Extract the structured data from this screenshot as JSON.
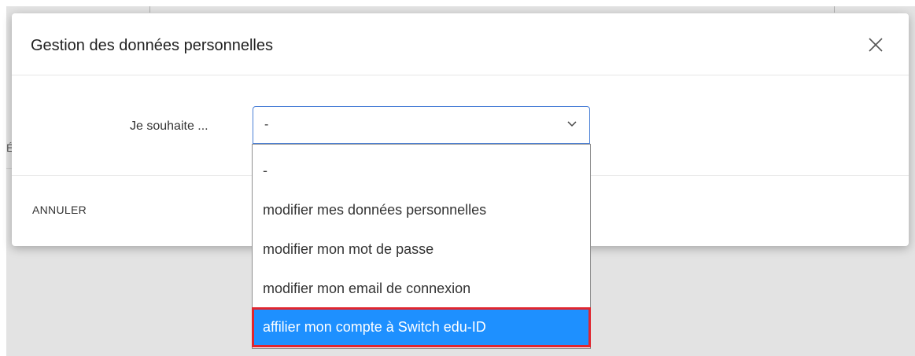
{
  "dialog": {
    "title": "Gestion des données personnelles",
    "close_icon": "close-icon",
    "cancel_label": "ANNULER"
  },
  "form": {
    "label": "Je souhaite ...",
    "selected_value": "-",
    "chevron_icon": "chevron-down-icon",
    "options": [
      "-",
      "modifier mes données personnelles",
      "modifier mon mot de passe",
      "modifier mon email de connexion",
      "affilier mon compte à Switch edu-ID"
    ],
    "highlighted_index": 4
  },
  "background": {
    "fragment_text": "É"
  },
  "colors": {
    "highlight_bg": "#1e90ff",
    "highlight_border": "#e0262f",
    "focus_border": "#4a7fd6"
  }
}
